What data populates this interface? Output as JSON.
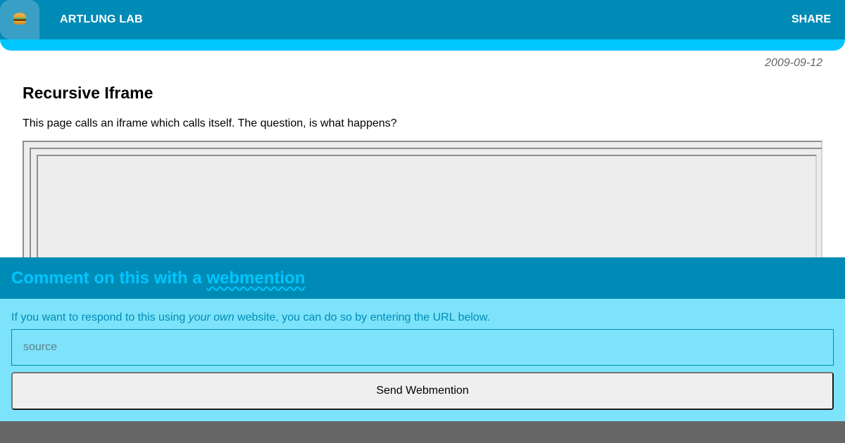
{
  "header": {
    "menu_icon": "hamburger-icon",
    "site_title": "ARTLUNG LAB",
    "share_label": "SHARE"
  },
  "colors": {
    "header_bg": "#008bb6",
    "accent": "#00c6ff",
    "panel_bg": "#7de3fa",
    "footer_bg": "#666666"
  },
  "post": {
    "date": "2009-09-12",
    "title": "Recursive Iframe",
    "body": "This page calls an iframe which calls itself. The question, is what happens?"
  },
  "webmention": {
    "title_prefix": "Comment on this with a ",
    "title_link": "webmention",
    "desc_before": "If you want to respond to this using ",
    "desc_em": "your own",
    "desc_after": " website, you can do so by entering the URL below.",
    "input_placeholder": "source",
    "input_value": "",
    "button_label": "Send Webmention"
  }
}
